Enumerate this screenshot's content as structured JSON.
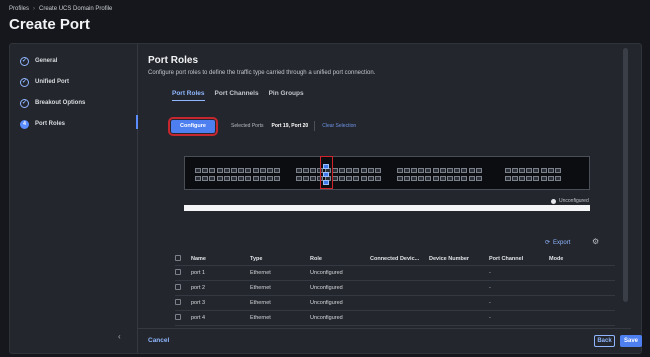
{
  "breadcrumb": [
    "Profiles",
    "Create UCS Domain Profile"
  ],
  "page_title": "Create Port",
  "steps": [
    {
      "label": "General",
      "state": "done"
    },
    {
      "label": "Unified Port",
      "state": "done"
    },
    {
      "label": "Breakout Options",
      "state": "done"
    },
    {
      "label": "Port Roles",
      "state": "active",
      "number": "4"
    }
  ],
  "section": {
    "title": "Port Roles",
    "description": "Configure port roles to define the traffic type carried through a unified port connection."
  },
  "tabs": [
    "Port Roles",
    "Port Channels",
    "Pin Groups"
  ],
  "toolbar": {
    "configure_label": "Configure",
    "selected_ports_label": "Selected Ports",
    "selected_ports_value": "Port 19, Port 20",
    "clear_label": "Clear Selection"
  },
  "legend": {
    "unconfigured": "Unconfigured"
  },
  "export_label": "Export",
  "table": {
    "columns": [
      "Name",
      "Type",
      "Role",
      "Connected Devic...",
      "Device Number",
      "Port Channel",
      "Mode"
    ],
    "rows": [
      {
        "name": "port 1",
        "type": "Ethernet",
        "role": "Unconfigured",
        "connected": "",
        "device_number": "",
        "port_channel": "-",
        "mode": ""
      },
      {
        "name": "port 2",
        "type": "Ethernet",
        "role": "Unconfigured",
        "connected": "",
        "device_number": "",
        "port_channel": "-",
        "mode": ""
      },
      {
        "name": "port 3",
        "type": "Ethernet",
        "role": "Unconfigured",
        "connected": "",
        "device_number": "",
        "port_channel": "-",
        "mode": ""
      },
      {
        "name": "port 4",
        "type": "Ethernet",
        "role": "Unconfigured",
        "connected": "",
        "device_number": "",
        "port_channel": "-",
        "mode": ""
      }
    ]
  },
  "footer": {
    "cancel_label": "Cancel",
    "back_label": "Back",
    "save_label": "Save"
  },
  "colors": {
    "accent": "#4d7ff0",
    "highlight": "#d0232c",
    "background": "#15171c"
  },
  "icons": {
    "step_done": "check-circle-icon",
    "collapse": "chevron-left-icon",
    "export": "export-icon",
    "settings": "gear-icon"
  }
}
